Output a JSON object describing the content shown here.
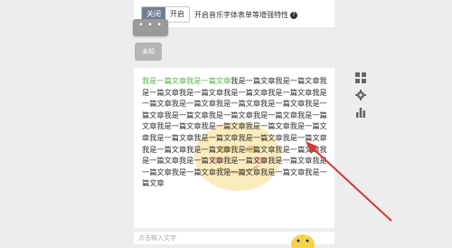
{
  "toolbar": {
    "toggle_off_label": "关闭",
    "toggle_on_label": "开启",
    "option_label": "开启音乐字体表单等增强特性",
    "help_symbol": "?"
  },
  "more_button": {
    "label": "• • •"
  },
  "unknown_button": {
    "label": "未知"
  },
  "article": {
    "highlight": "我是一篇文章我是一篇文章",
    "body": "我是一篇文章我是一篇文章我是一篇文章我是一篇文章我是一篇文章我是一篇文章我是一篇文章我是一篇文章我是一篇文章我是一篇文章我是一篇文章我是一篇文章我是一篇文章我是一篇文章我是一篇文章我是一篇文章我是一篇文章我是一篇文章我是一篇文章我是一篇文章我是一篇文章我是一篇文章我是一篇文章我是一篇文章我是一篇文章我是一篇文章我是一篇文章我是一篇文章我是一篇文章我是一篇文章我是一篇文章我是一篇文章我是一篇文章我是一篇文章我是一篇文章我是一篇文章"
  },
  "side_icons": [
    "grid-icon",
    "gear-icon",
    "bar-chart-icon"
  ],
  "input": {
    "placeholder": "点击输入文字"
  },
  "colors": {
    "highlight": "#5ab54b",
    "arrow": "#d03a3a",
    "toggle_off_bg": "#6f7f92"
  }
}
